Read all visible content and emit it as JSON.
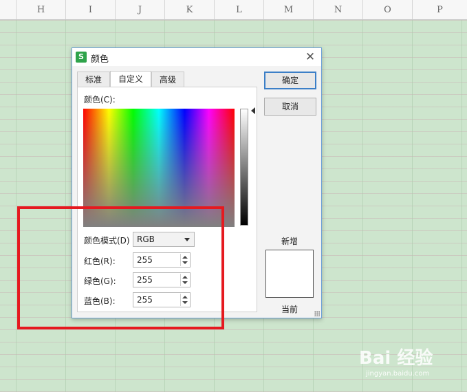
{
  "sheet": {
    "columns": [
      "H",
      "I",
      "J",
      "K",
      "L",
      "M",
      "N",
      "O",
      "P"
    ]
  },
  "dialog": {
    "title": "颜色",
    "app_icon_letter": "S",
    "close_glyph": "✕",
    "tabs": [
      {
        "label": "标准",
        "active": false
      },
      {
        "label": "自定义",
        "active": true
      },
      {
        "label": "高级",
        "active": false
      }
    ],
    "color_label": "颜色(C):",
    "mode_label": "颜色模式(D)",
    "mode_value": "RGB",
    "red_label": "红色(R):",
    "red_value": "255",
    "green_label": "绿色(G):",
    "green_value": "255",
    "blue_label": "蓝色(B):",
    "blue_value": "255",
    "ok_label": "确定",
    "cancel_label": "取消",
    "new_label": "新增",
    "current_label": "当前",
    "preview_color": "#ffffff"
  },
  "annotation": {
    "color": "#e5191f"
  },
  "watermark": {
    "text": "Bai 经验",
    "url": "jingyan.baidu.com"
  }
}
